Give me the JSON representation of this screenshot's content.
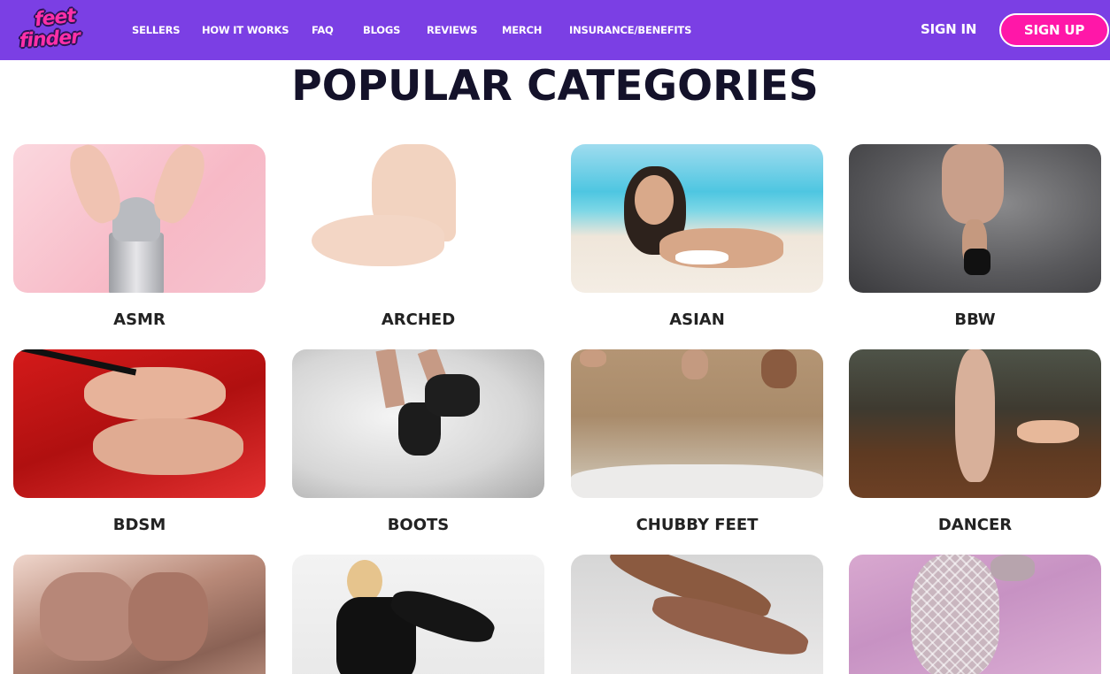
{
  "brand": {
    "logo_line1": "feet",
    "logo_line2": "finder"
  },
  "nav": {
    "links": [
      "SELLERS",
      "HOW IT WORKS",
      "FAQ",
      "BLOGS",
      "REVIEWS",
      "MERCH",
      "INSURANCE/BENEFITS"
    ],
    "sign_in": "SIGN IN",
    "sign_up": "SIGN UP"
  },
  "colors": {
    "nav_bg": "#7b3fe4",
    "sign_up_bg": "#ff17a8",
    "title_text": "#14122a"
  },
  "main": {
    "title": "POPULAR CATEGORIES",
    "categories": [
      {
        "label": "ASMR"
      },
      {
        "label": "ARCHED"
      },
      {
        "label": "ASIAN"
      },
      {
        "label": "BBW"
      },
      {
        "label": "BDSM"
      },
      {
        "label": "BOOTS"
      },
      {
        "label": "CHUBBY FEET"
      },
      {
        "label": "DANCER"
      },
      {
        "label": ""
      },
      {
        "label": ""
      },
      {
        "label": ""
      },
      {
        "label": ""
      }
    ]
  }
}
